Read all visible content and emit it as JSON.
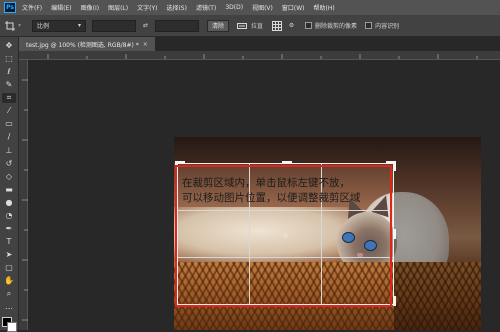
{
  "app": {
    "logo": "Ps"
  },
  "menubar": {
    "items": [
      "文件(F)",
      "编辑(E)",
      "图像(I)",
      "图层(L)",
      "文字(Y)",
      "选择(S)",
      "滤镜(T)",
      "3D(D)",
      "视图(V)",
      "窗口(W)",
      "帮助(H)"
    ]
  },
  "options_bar": {
    "ratio_select": "比例",
    "clear_label": "清除",
    "straighten_label": "拉直",
    "delete_cropped_label": "删除裁剪的像素",
    "content_aware_label": "内容识别"
  },
  "document": {
    "tab_title": "test.jpg @ 100% (检测图选, RGB/8#) *",
    "close_glyph": "×"
  },
  "annotation": {
    "text": "在裁剪区域内，单击鼠标左键不放，\n可以移动图片位置，以便调整裁剪区域"
  },
  "colors": {
    "annotation_frame": "#e0261c",
    "ui_dark": "#282828",
    "ui_panel": "#424242"
  }
}
